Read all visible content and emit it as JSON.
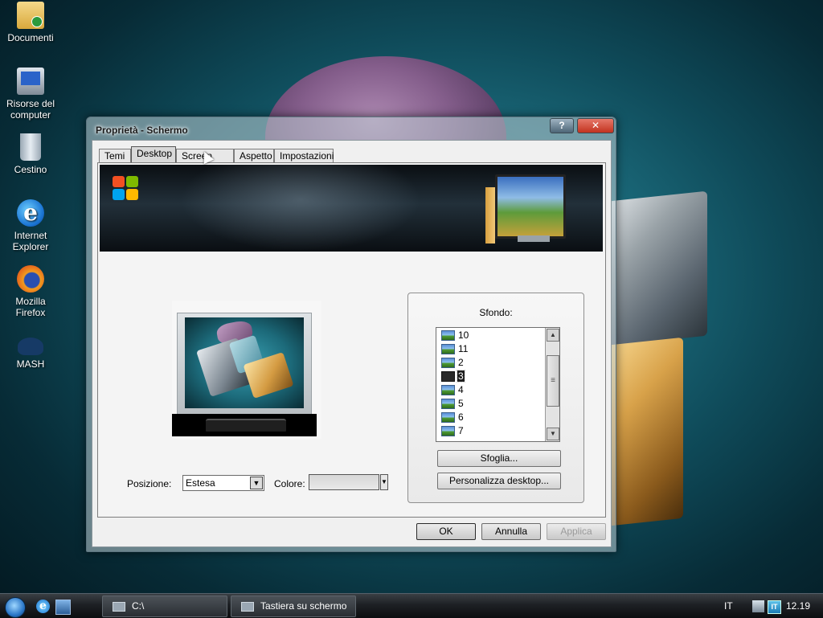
{
  "desktop": {
    "icons": [
      {
        "label": "Documenti",
        "icon": "folder-icon"
      },
      {
        "label": "Risorse del computer",
        "icon": "computer-icon"
      },
      {
        "label": "Cestino",
        "icon": "recycle-bin-icon"
      },
      {
        "label": "Internet Explorer",
        "icon": "internet-explorer-icon"
      },
      {
        "label": "Mozilla Firefox",
        "icon": "firefox-icon"
      },
      {
        "label": "MASH",
        "icon": "mash-icon"
      }
    ]
  },
  "dialog": {
    "title": "Proprietà - Schermo",
    "help_button": "?",
    "close_button": "✕",
    "tabs": [
      {
        "label": "Temi"
      },
      {
        "label": "Desktop",
        "active": true
      },
      {
        "label": "Screen saver"
      },
      {
        "label": "Aspetto"
      },
      {
        "label": "Impostazioni"
      }
    ],
    "position_label": "Posizione:",
    "position_value": "Estesa",
    "color_label": "Colore:",
    "background": {
      "title": "Sfondo:",
      "items": [
        {
          "label": "10"
        },
        {
          "label": "11"
        },
        {
          "label": "2"
        },
        {
          "label": "3",
          "selected": true
        },
        {
          "label": "4"
        },
        {
          "label": "5"
        },
        {
          "label": "6"
        },
        {
          "label": "7"
        }
      ],
      "browse_button": "Sfoglia...",
      "customize_button": "Personalizza desktop..."
    },
    "ok_button": "OK",
    "cancel_button": "Annulla",
    "apply_button": "Applica"
  },
  "taskbar": {
    "tasks": [
      {
        "label": "C:\\"
      },
      {
        "label": "Tastiera su schermo"
      }
    ],
    "language": "IT",
    "clock": "12.19"
  }
}
